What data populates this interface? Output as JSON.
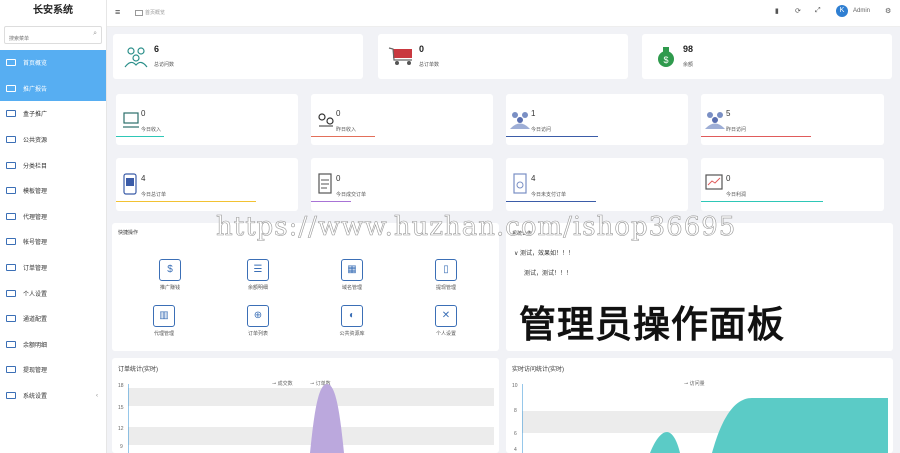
{
  "sidebar": {
    "title": "长安系统",
    "search_placeholder": "搜索菜单",
    "items": [
      {
        "label": "首页概览",
        "active": true
      },
      {
        "label": "推广报告",
        "active": true
      },
      {
        "label": "盒子推广"
      },
      {
        "label": "公共资源"
      },
      {
        "label": "分类栏目"
      },
      {
        "label": "模板管理"
      },
      {
        "label": "代理管理"
      },
      {
        "label": "帐号管理"
      },
      {
        "label": "订单管理"
      },
      {
        "label": "个人设置"
      },
      {
        "label": "通道配置"
      },
      {
        "label": "余额明细"
      },
      {
        "label": "提现管理"
      },
      {
        "label": "系统设置",
        "has_arrow": true
      }
    ]
  },
  "topbar": {
    "breadcrumb": "首页概览",
    "user": "Admin"
  },
  "stats_top": [
    {
      "value": "6",
      "label": "总访问数"
    },
    {
      "value": "0",
      "label": "总订单数"
    },
    {
      "value": "98",
      "label": "余额"
    }
  ],
  "stats_row2": [
    {
      "value": "0",
      "label": "今日收入",
      "color": "#2ec7b7"
    },
    {
      "value": "0",
      "label": "昨日收入",
      "color": "#e36f5a"
    },
    {
      "value": "1",
      "label": "今日访问",
      "color": "#3b5ca8"
    },
    {
      "value": "5",
      "label": "昨日访问",
      "color": "#e05b5b"
    }
  ],
  "stats_row3": [
    {
      "value": "4",
      "label": "今日总订单",
      "color": "#f2c233"
    },
    {
      "value": "0",
      "label": "今日成交订单",
      "color": "#a873d6"
    },
    {
      "value": "4",
      "label": "今日未支付订单",
      "color": "#3b5ca8"
    },
    {
      "value": "0",
      "label": "今日利润",
      "color": "#2ec7b7"
    }
  ],
  "quick": {
    "title": "快捷操作",
    "items": [
      {
        "label": "推广赚钱",
        "icon": "$"
      },
      {
        "label": "余额明细",
        "icon": "☰"
      },
      {
        "label": "域名管理",
        "icon": "▦"
      },
      {
        "label": "提现管理",
        "icon": "▯"
      },
      {
        "label": "代理管理",
        "icon": "▥"
      },
      {
        "label": "订单列表",
        "icon": "⊕"
      },
      {
        "label": "公共资源库",
        "icon": "◐"
      },
      {
        "label": "个人设置",
        "icon": "✕"
      }
    ]
  },
  "notice": {
    "title": "系统公告",
    "line1": "∨ 测试，效果如！！！",
    "line2": "测试，测试！！！"
  },
  "overlay_text": "管理员操作面板",
  "watermark": "https://www.huzhan.com/ishop36695",
  "chart_left": {
    "title": "订单统计(实时)",
    "legend": [
      "成交数",
      "订单数"
    ],
    "y_ticks": [
      "18",
      "15",
      "12",
      "9"
    ]
  },
  "chart_right": {
    "title": "实时访问统计(实时)",
    "legend": [
      "访问量"
    ],
    "y_ticks": [
      "10",
      "8",
      "6",
      "4"
    ]
  },
  "chart_data": [
    {
      "type": "area",
      "title": "订单统计(实时)",
      "series": [
        {
          "name": "订单数",
          "peak": 18
        },
        {
          "name": "成交数"
        }
      ],
      "ylim": [
        0,
        18
      ]
    },
    {
      "type": "area",
      "title": "实时访问统计(实时)",
      "series": [
        {
          "name": "访问量"
        }
      ],
      "ylim": [
        0,
        10
      ]
    }
  ]
}
